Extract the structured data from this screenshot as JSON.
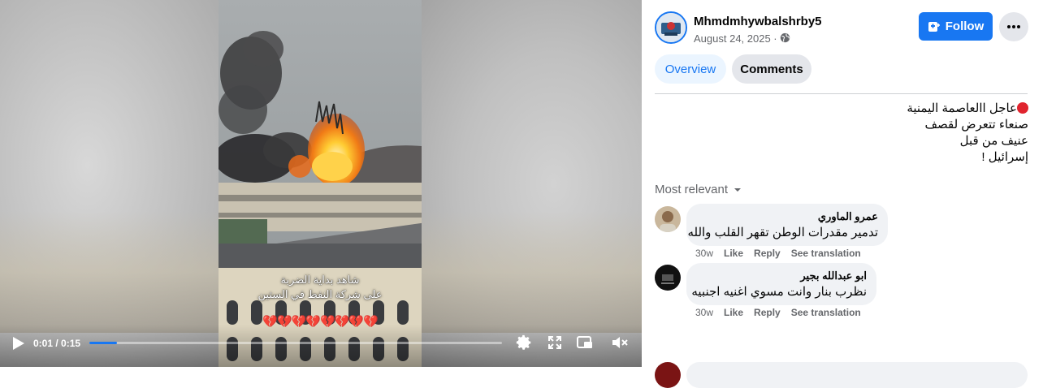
{
  "video": {
    "overlay_caption_line1": "شاهد بداية الضربة",
    "overlay_caption_line2": "على شركة النفط في الستين",
    "overlay_hearts": "💔💔💔💔💔💔💔💔",
    "time": "0:01 / 0:15",
    "progress": 0.067
  },
  "post": {
    "author": "Mhmdmhywbalshrby5",
    "date": "August 24, 2025 ·",
    "follow_label": "Follow",
    "tabs": [
      {
        "label": "Overview",
        "active": true
      },
      {
        "label": "Comments",
        "active": false
      }
    ],
    "text_lines": [
      "عاجل االعاصمة اليمنية",
      "صنعاء تتعرض لقصف",
      "عنيف من قبل",
      "إسرائيل !"
    ]
  },
  "comments": {
    "sort_label": "Most relevant",
    "items": [
      {
        "name": "عمرو الماوري",
        "text": "تدمير مقدرات الوطن تقهر القلب والله",
        "time": "30w",
        "like": "Like",
        "reply": "Reply",
        "translate": "See translation"
      },
      {
        "name": "ابو عبدالله بجير",
        "text": "نظرب بنار وانت مسوي اغنيه اجنبيه",
        "time": "30w",
        "like": "Like",
        "reply": "Reply",
        "translate": "See translation"
      }
    ]
  },
  "colors": {
    "accent": "#1877f2",
    "tab_bg": "#e4e6eb",
    "red_dot": "#e0242e"
  },
  "icons": [
    "play-icon",
    "settings-icon",
    "fullscreen-icon",
    "pip-icon",
    "mute-icon",
    "globe-icon",
    "follow-icon",
    "more-icon",
    "chevron-down-icon"
  ]
}
